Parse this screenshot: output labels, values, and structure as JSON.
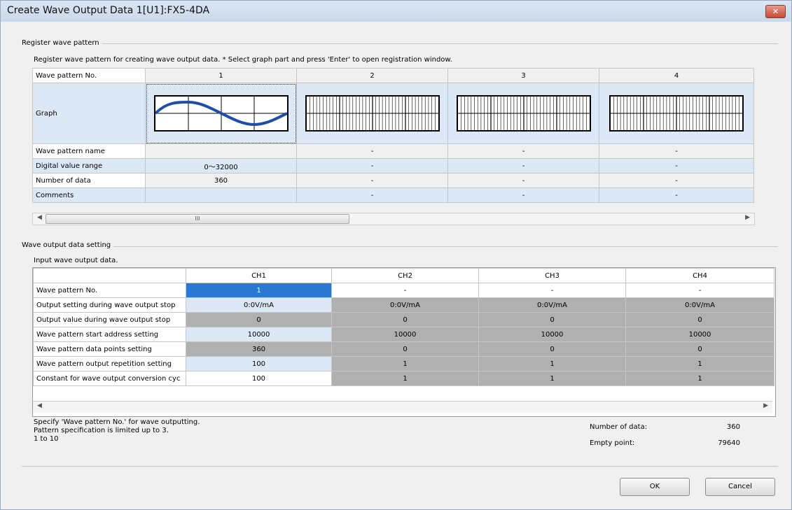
{
  "window": {
    "title": "Create Wave Output Data  1[U1]:FX5-4DA",
    "close_glyph": "✕"
  },
  "register": {
    "group_label": "Register wave pattern",
    "hint": "Register wave pattern for creating wave output data. * Select graph part and press 'Enter' to open registration window.",
    "row_labels": {
      "no": "Wave pattern No.",
      "graph": "Graph",
      "name": "Wave pattern name",
      "range": "Digital value range",
      "count": "Number of data",
      "comments": "Comments"
    },
    "patterns": [
      {
        "no": "1",
        "name": "",
        "range": "0～32000",
        "count": "360",
        "comments": "",
        "has_wave": true
      },
      {
        "no": "2",
        "name": "-",
        "range": "-",
        "count": "-",
        "comments": "-",
        "has_wave": false
      },
      {
        "no": "3",
        "name": "-",
        "range": "-",
        "count": "-",
        "comments": "-",
        "has_wave": false
      },
      {
        "no": "4",
        "name": "-",
        "range": "-",
        "count": "-",
        "comments": "-",
        "has_wave": false
      }
    ],
    "scroll_thumb": "III",
    "wave_color": "#1f4ea8"
  },
  "output": {
    "group_label": "Wave output data setting",
    "hint": "Input wave output data.",
    "channels": [
      "CH1",
      "CH2",
      "CH3",
      "CH4"
    ],
    "rows": [
      {
        "label": "Wave pattern No.",
        "values": [
          "1",
          "-",
          "-",
          "-"
        ]
      },
      {
        "label": "Output setting during wave output stop",
        "values": [
          "0:0V/mA",
          "0:0V/mA",
          "0:0V/mA",
          "0:0V/mA"
        ]
      },
      {
        "label": "Output value during wave output stop",
        "values": [
          "0",
          "0",
          "0",
          "0"
        ]
      },
      {
        "label": "Wave pattern start address setting",
        "values": [
          "10000",
          "10000",
          "10000",
          "10000"
        ]
      },
      {
        "label": "Wave pattern data points setting",
        "values": [
          "360",
          "0",
          "0",
          "0"
        ]
      },
      {
        "label": "Wave pattern output repetition setting",
        "values": [
          "100",
          "1",
          "1",
          "1"
        ]
      },
      {
        "label": "Constant for wave output conversion cyc",
        "values": [
          "100",
          "1",
          "1",
          "1"
        ]
      }
    ]
  },
  "info": {
    "line1": "Specify 'Wave pattern No.' for wave outputting.",
    "line2": "Pattern specification is limited up to 3.",
    "line3": "1 to 10",
    "num_data_label": "Number of data:",
    "num_data_value": "360",
    "empty_label": "Empty point:",
    "empty_value": "79640"
  },
  "buttons": {
    "ok": "OK",
    "cancel": "Cancel"
  },
  "colors": {
    "selected": "#2a78d2",
    "disabled_cell": "#b0b0b0",
    "light_blue": "#dde8f6"
  }
}
